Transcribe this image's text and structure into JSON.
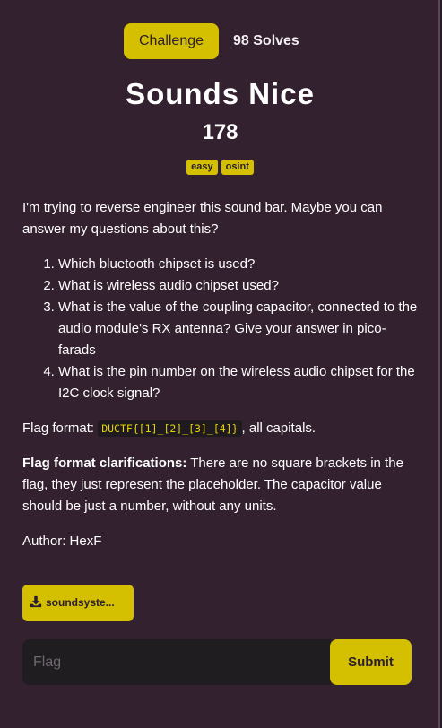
{
  "tabs": {
    "challenge": "Challenge",
    "solves": "98 Solves"
  },
  "challenge": {
    "title": "Sounds Nice",
    "points": "178",
    "tags": [
      "easy",
      "osint"
    ],
    "intro": "I'm trying to reverse engineer this sound bar. Maybe you can answer my questions about this?",
    "questions": [
      "Which bluetooth chipset is used?",
      "What is wireless audio chipset used?",
      "What is the value of the coupling capacitor, connected to the audio module's RX antenna? Give your answer in pico-farads",
      "What is the pin number on the wireless audio chipset for the I2C clock signal?"
    ],
    "flag_format_label": "Flag format:",
    "flag_format_code": "DUCTF{[1]_[2]_[3]_[4]}",
    "flag_format_suffix": ", all capitals.",
    "clarification_label": "Flag format clarifications:",
    "clarification_text": " There are no square brackets in the flag, they just represent the placeholder. The capacitor value should be just a number, without any units.",
    "author": "Author: HexF"
  },
  "file": {
    "label": "soundsyste...",
    "icon": "download-icon"
  },
  "flag_form": {
    "placeholder": "Flag",
    "value": "",
    "submit_label": "Submit"
  },
  "colors": {
    "accent": "#d4c000",
    "background": "#34212f",
    "input_bg": "#1f1d1f"
  }
}
